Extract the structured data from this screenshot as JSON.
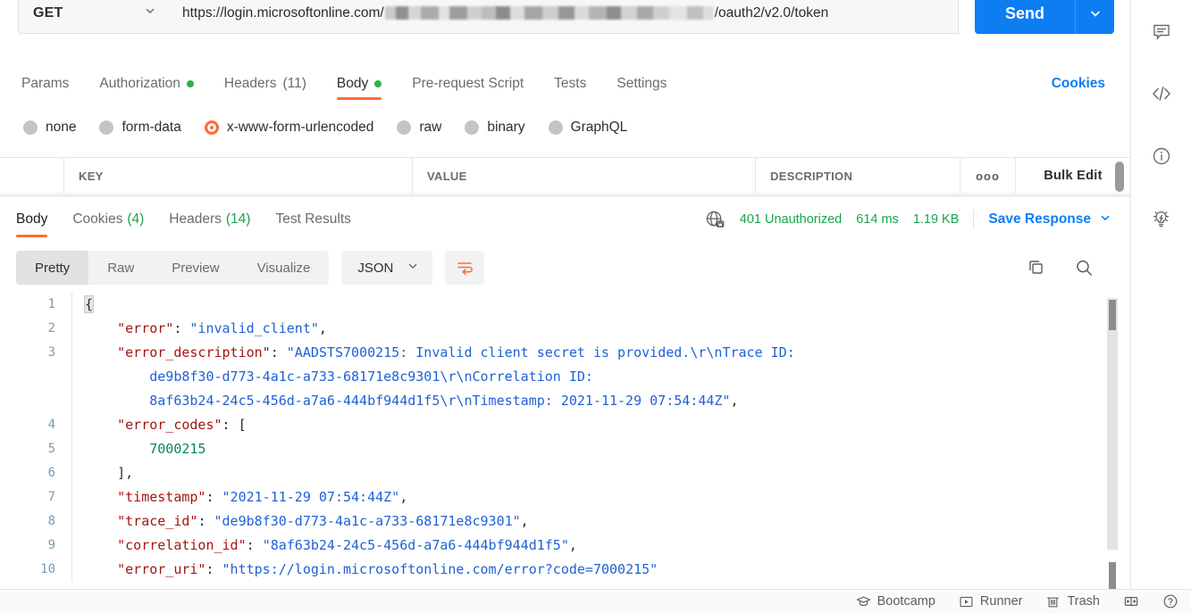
{
  "request": {
    "method": "GET",
    "url_prefix": "https://login.microsoftonline.com/",
    "url_suffix": "/oauth2/v2.0/token",
    "url_redacted_note": "redacted-tenant-id",
    "send_label": "Send"
  },
  "request_tabs": [
    {
      "label": "Params",
      "dot": false,
      "count": "",
      "active": false
    },
    {
      "label": "Authorization",
      "dot": true,
      "count": "",
      "active": false
    },
    {
      "label": "Headers",
      "dot": false,
      "count": "(11)",
      "active": false
    },
    {
      "label": "Body",
      "dot": true,
      "count": "",
      "active": true
    },
    {
      "label": "Pre-request Script",
      "dot": false,
      "count": "",
      "active": false
    },
    {
      "label": "Tests",
      "dot": false,
      "count": "",
      "active": false
    },
    {
      "label": "Settings",
      "dot": false,
      "count": "",
      "active": false
    }
  ],
  "cookies_link": "Cookies",
  "body_types": [
    {
      "label": "none",
      "selected": false
    },
    {
      "label": "form-data",
      "selected": false
    },
    {
      "label": "x-www-form-urlencoded",
      "selected": true
    },
    {
      "label": "raw",
      "selected": false
    },
    {
      "label": "binary",
      "selected": false
    },
    {
      "label": "GraphQL",
      "selected": false
    }
  ],
  "kv_table": {
    "key_header": "KEY",
    "value_header": "VALUE",
    "description_header": "DESCRIPTION",
    "options_glyph": "ooo",
    "bulk_edit_label": "Bulk Edit"
  },
  "response": {
    "tabs": [
      {
        "label": "Body",
        "count": "",
        "active": true
      },
      {
        "label": "Cookies",
        "count": "(4)",
        "active": false
      },
      {
        "label": "Headers",
        "count": "(14)",
        "active": false
      },
      {
        "label": "Test Results",
        "count": "",
        "active": false
      }
    ],
    "status": "401 Unauthorized",
    "time": "614 ms",
    "size": "1.19 KB",
    "save_response_label": "Save Response",
    "status_color": "#1aa34a",
    "link_color": "#0d7ef2",
    "accent_color": "#ff6c37"
  },
  "viewer": {
    "modes": [
      {
        "label": "Pretty",
        "active": true
      },
      {
        "label": "Raw",
        "active": false
      },
      {
        "label": "Preview",
        "active": false
      },
      {
        "label": "Visualize",
        "active": false
      }
    ],
    "format": "JSON"
  },
  "code": {
    "lines": [
      {
        "num": "1",
        "parts": [
          {
            "t": "{",
            "c": "brk-hl p"
          }
        ]
      },
      {
        "num": "2",
        "parts": [
          {
            "t": "    ",
            "c": "p"
          },
          {
            "t": "\"error\"",
            "c": "k"
          },
          {
            "t": ": ",
            "c": "p"
          },
          {
            "t": "\"invalid_client\"",
            "c": "s"
          },
          {
            "t": ",",
            "c": "p"
          }
        ]
      },
      {
        "num": "3",
        "parts": [
          {
            "t": "    ",
            "c": "p"
          },
          {
            "t": "\"error_description\"",
            "c": "k"
          },
          {
            "t": ": ",
            "c": "p"
          },
          {
            "t": "\"AADSTS7000215: Invalid client secret is provided.\\r\\nTrace ID:",
            "c": "s"
          }
        ]
      },
      {
        "num": "",
        "parts": [
          {
            "t": "        de9b8f30-d773-4a1c-a733-68171e8c9301\\r\\nCorrelation ID:",
            "c": "s"
          }
        ]
      },
      {
        "num": "",
        "parts": [
          {
            "t": "        8af63b24-24c5-456d-a7a6-444bf944d1f5\\r\\nTimestamp: 2021-11-29 07:54:44Z\"",
            "c": "s"
          },
          {
            "t": ",",
            "c": "p"
          }
        ]
      },
      {
        "num": "4",
        "parts": [
          {
            "t": "    ",
            "c": "p"
          },
          {
            "t": "\"error_codes\"",
            "c": "k"
          },
          {
            "t": ": [",
            "c": "p"
          }
        ]
      },
      {
        "num": "5",
        "parts": [
          {
            "t": "        ",
            "c": "p"
          },
          {
            "t": "7000215",
            "c": "n"
          }
        ]
      },
      {
        "num": "6",
        "parts": [
          {
            "t": "    ],",
            "c": "p"
          }
        ]
      },
      {
        "num": "7",
        "parts": [
          {
            "t": "    ",
            "c": "p"
          },
          {
            "t": "\"timestamp\"",
            "c": "k"
          },
          {
            "t": ": ",
            "c": "p"
          },
          {
            "t": "\"2021-11-29 07:54:44Z\"",
            "c": "s"
          },
          {
            "t": ",",
            "c": "p"
          }
        ]
      },
      {
        "num": "8",
        "parts": [
          {
            "t": "    ",
            "c": "p"
          },
          {
            "t": "\"trace_id\"",
            "c": "k"
          },
          {
            "t": ": ",
            "c": "p"
          },
          {
            "t": "\"de9b8f30-d773-4a1c-a733-68171e8c9301\"",
            "c": "s"
          },
          {
            "t": ",",
            "c": "p"
          }
        ]
      },
      {
        "num": "9",
        "parts": [
          {
            "t": "    ",
            "c": "p"
          },
          {
            "t": "\"correlation_id\"",
            "c": "k"
          },
          {
            "t": ": ",
            "c": "p"
          },
          {
            "t": "\"8af63b24-24c5-456d-a7a6-444bf944d1f5\"",
            "c": "s"
          },
          {
            "t": ",",
            "c": "p"
          }
        ]
      },
      {
        "num": "10",
        "parts": [
          {
            "t": "    ",
            "c": "p"
          },
          {
            "t": "\"error_uri\"",
            "c": "k"
          },
          {
            "t": ": ",
            "c": "p"
          },
          {
            "t": "\"https://login.microsoftonline.com/error?code=7000215\"",
            "c": "s"
          }
        ]
      }
    ]
  },
  "status_bar": [
    {
      "label": "Bootcamp",
      "icon": "graduation-cap-icon"
    },
    {
      "label": "Runner",
      "icon": "play-box-icon"
    },
    {
      "label": "Trash",
      "icon": "trash-icon"
    },
    {
      "label": "",
      "icon": "layout-panel-icon"
    },
    {
      "label": "",
      "icon": "help-circle-icon"
    }
  ],
  "right_rail": [
    {
      "icon": "comment-icon"
    },
    {
      "icon": "code-icon"
    },
    {
      "icon": "info-circle-icon"
    },
    {
      "icon": "lightbulb-icon"
    }
  ]
}
